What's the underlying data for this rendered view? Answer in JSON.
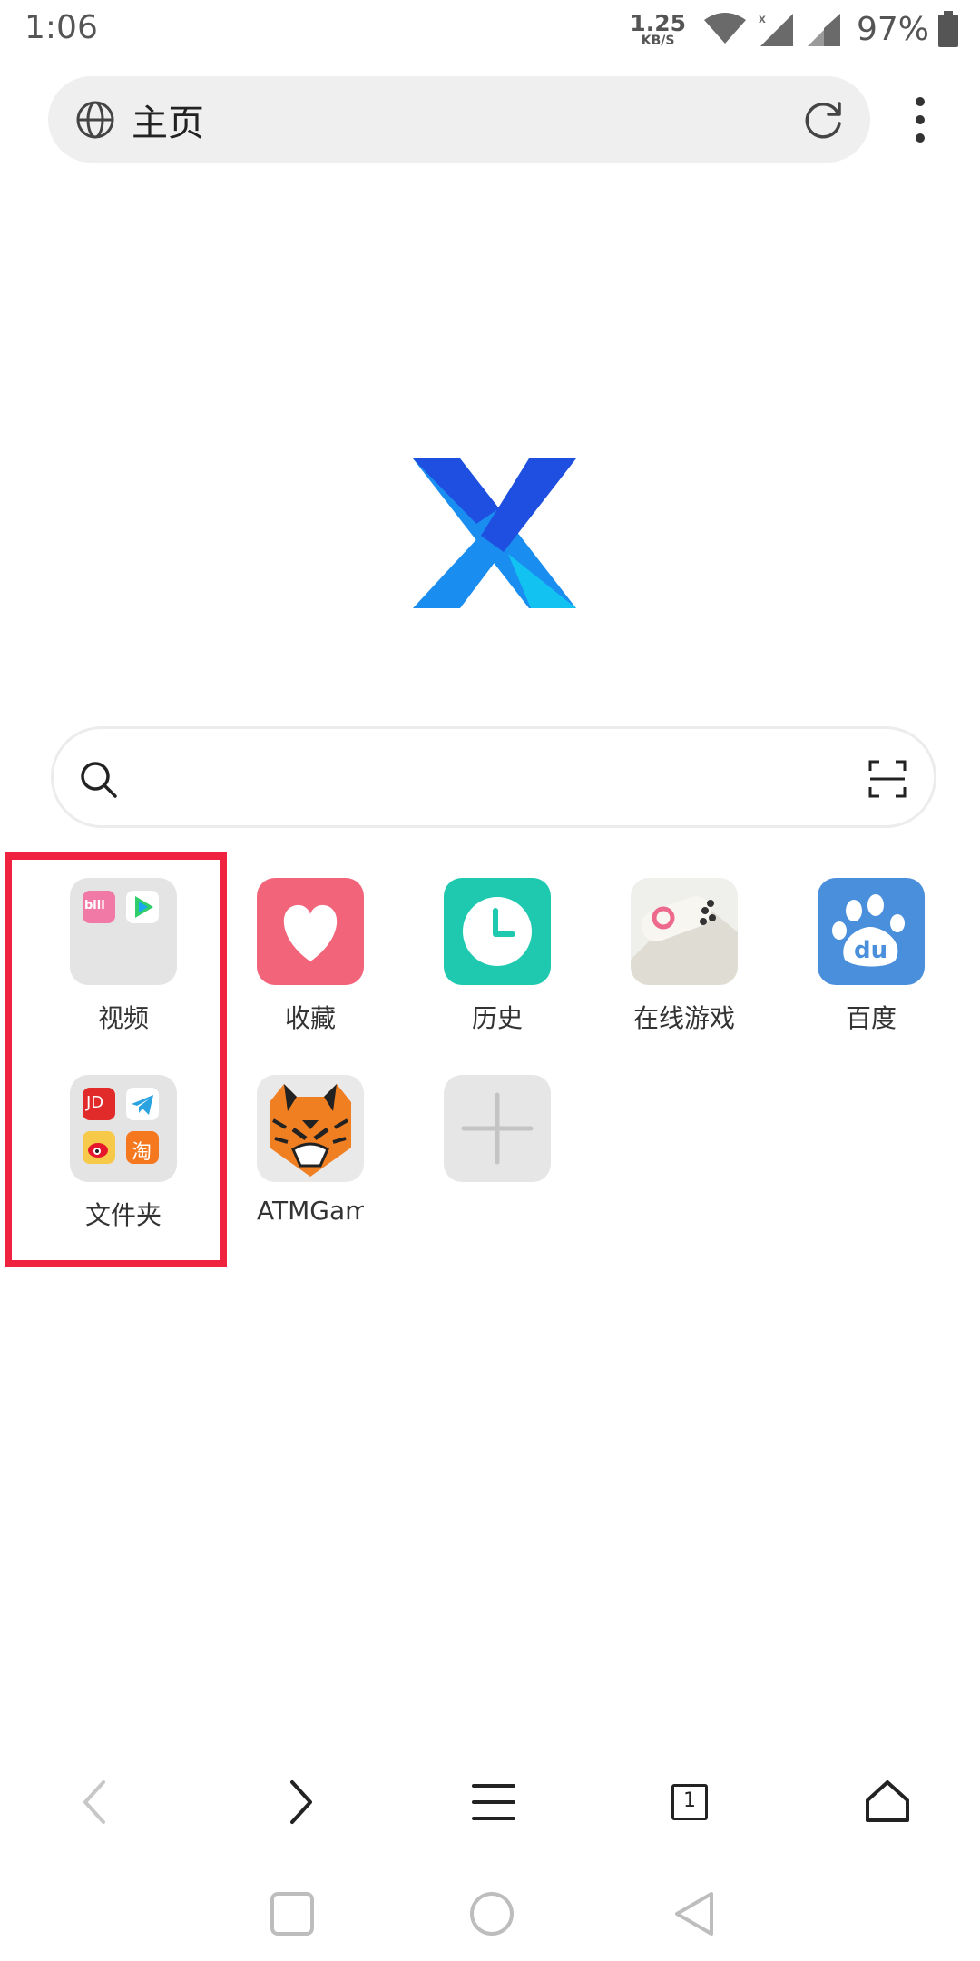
{
  "status_bar": {
    "time": "1:06",
    "net_speed_value": "1.25",
    "net_speed_unit": "KB/S",
    "battery": "97%",
    "icons": [
      "wifi-icon",
      "cell-signal-icon",
      "cell-signal-icon",
      "battery-icon"
    ]
  },
  "address_bar": {
    "title": "主页",
    "icons": [
      "globe-icon",
      "reload-icon",
      "more-vert-icon"
    ]
  },
  "logo": {
    "icon": "x-browser-logo",
    "colors": [
      "#1f4fe0",
      "#1a8df0",
      "#12c3f2"
    ]
  },
  "search": {
    "icons": [
      "search-icon",
      "scan-icon"
    ]
  },
  "shortcuts": [
    {
      "label": "视频",
      "type": "folder",
      "contents": [
        "bilibili-icon",
        "tencent-video-icon"
      ]
    },
    {
      "label": "收藏",
      "icon": "heart-icon",
      "color": "#f2647a"
    },
    {
      "label": "历史",
      "icon": "clock-icon",
      "color": "#1ec9b0"
    },
    {
      "label": "在线游戏",
      "icon": "game-controller-icon"
    },
    {
      "label": "百度",
      "icon": "baidu-paw-icon",
      "color": "#4a8fdb"
    },
    {
      "label": "文件夹",
      "type": "folder",
      "contents": [
        "jd-icon",
        "telegram-icon",
        "weibo-icon",
        "taobao-icon"
      ]
    },
    {
      "label": "ATMGam",
      "icon": "tiger-icon"
    },
    {
      "label": "",
      "icon": "add-icon"
    }
  ],
  "mini_labels": {
    "jd": "JD",
    "taobao": "淘",
    "bilibili": "bili"
  },
  "toolbar": {
    "tab_count": "1",
    "icons": [
      "back-icon",
      "forward-icon",
      "menu-icon",
      "tabs-icon",
      "home-icon"
    ]
  },
  "system_nav": {
    "icons": [
      "recents-icon",
      "home-circle-icon",
      "back-triangle-icon"
    ]
  },
  "highlight_color": "#ef2340"
}
